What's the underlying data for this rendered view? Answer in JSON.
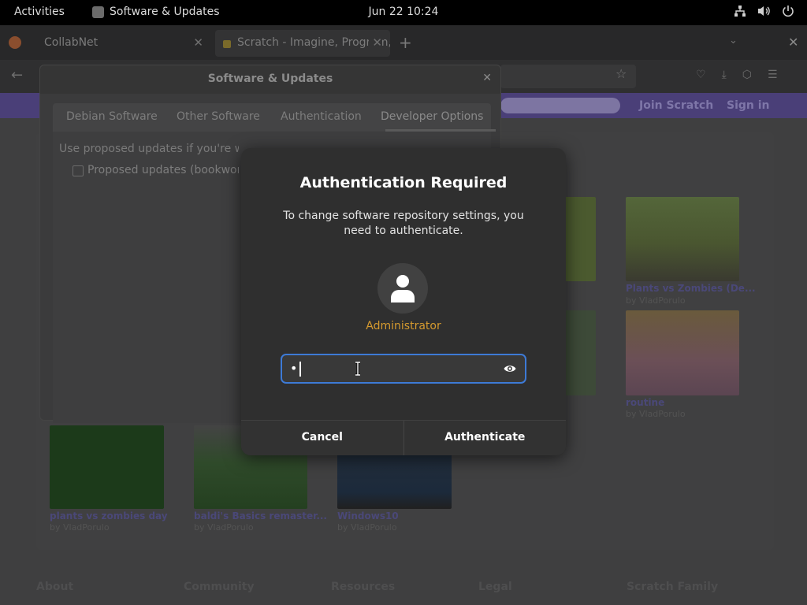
{
  "topbar": {
    "activities": "Activities",
    "app_name": "Software & Updates",
    "clock": "Jun 22  10:24",
    "tray_icons": [
      "network-icon",
      "volume-icon",
      "power-icon"
    ]
  },
  "browser": {
    "tabs": [
      {
        "label": "CollabNet"
      },
      {
        "label": "Scratch - Imagine, Program, Share"
      }
    ]
  },
  "scratch": {
    "join": "Join Scratch",
    "sign_in": "Sign in",
    "projects": [
      {
        "title": "Plants vs Zombies (De...",
        "by": "by VladPorulo"
      },
      {
        "title": "routine",
        "by": "by VladPorulo"
      },
      {
        "title": "plants vs zombies day",
        "by": "by VladPorulo"
      },
      {
        "title": "baldi's Basics remaster...",
        "by": "by VladPorulo"
      },
      {
        "title": "Windows10",
        "by": "by VladPorulo"
      }
    ],
    "footer": [
      "About",
      "Community",
      "Resources",
      "Legal",
      "Scratch Family"
    ]
  },
  "software_updates": {
    "title": "Software & Updates",
    "tabs": [
      "Debian Software",
      "Other Software",
      "Authentication",
      "Developer Options"
    ],
    "active_tab": "Developer Options",
    "description": "Use proposed updates if you're willing to provide ... More that ...",
    "checkbox_label": "Proposed updates (bookworm-proposed-updates)"
  },
  "auth_dialog": {
    "title": "Authentication Required",
    "message": "To change software repository settings, you need to authenticate.",
    "user": "Administrator",
    "password_mask": "•",
    "cancel": "Cancel",
    "authenticate": "Authenticate",
    "colors": {
      "accent": "#3d7ad6",
      "user": "#d59a2f",
      "dialog_bg": "#2f2f2f"
    }
  }
}
